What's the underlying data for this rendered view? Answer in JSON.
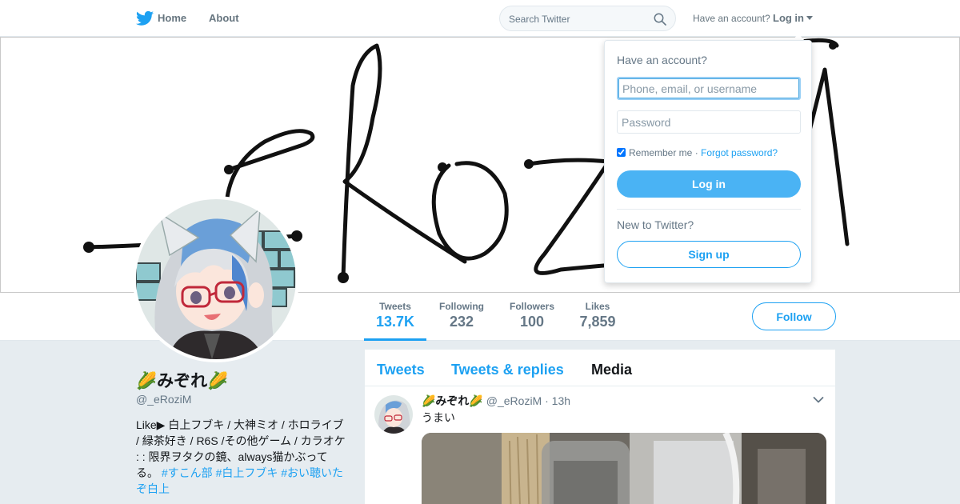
{
  "nav": {
    "logo_icon": "twitter-bird-icon",
    "home_label": "Home",
    "about_label": "About",
    "search_placeholder": "Search Twitter",
    "search_icon": "search-icon",
    "have_account_text": "Have an account?",
    "login_label": "Log in"
  },
  "banner": {
    "image_text": "-eRoziM"
  },
  "profile": {
    "name": "🌽みぞれ🌽",
    "handle": "@_eRoziM",
    "bio_text": "Like▶ 白上フブキ / 大神ミオ / ホロライブ / 緑茶好き / R6S /その他ゲーム / カラオケ : : 限界ヲタクの鏡、always猫かぶってる。",
    "hashtags": [
      "#すこん部",
      "#白上フブキ",
      "#おい聴いたぞ白上"
    ]
  },
  "stats": [
    {
      "label": "Tweets",
      "value": "13.7K"
    },
    {
      "label": "Following",
      "value": "232"
    },
    {
      "label": "Followers",
      "value": "100"
    },
    {
      "label": "Likes",
      "value": "7,859"
    }
  ],
  "follow_label": "Follow",
  "timeline": {
    "tabs": [
      {
        "label": "Tweets"
      },
      {
        "label": "Tweets & replies"
      },
      {
        "label": "Media"
      }
    ],
    "tweet": {
      "name": "🌽みぞれ🌽",
      "handle": "@_eRoziM",
      "time": "13h",
      "text": "うまい"
    }
  },
  "login_dropdown": {
    "title": "Have an account?",
    "username_placeholder": "Phone, email, or username",
    "password_placeholder": "Password",
    "remember_label": "Remember me",
    "separator": " · ",
    "forgot_label": "Forgot password?",
    "login_button": "Log in",
    "new_text": "New to Twitter?",
    "signup_button": "Sign up"
  },
  "colors": {
    "accent": "#1da1f2",
    "login_button": "#4ab3f4",
    "background": "#e6ecf0"
  }
}
